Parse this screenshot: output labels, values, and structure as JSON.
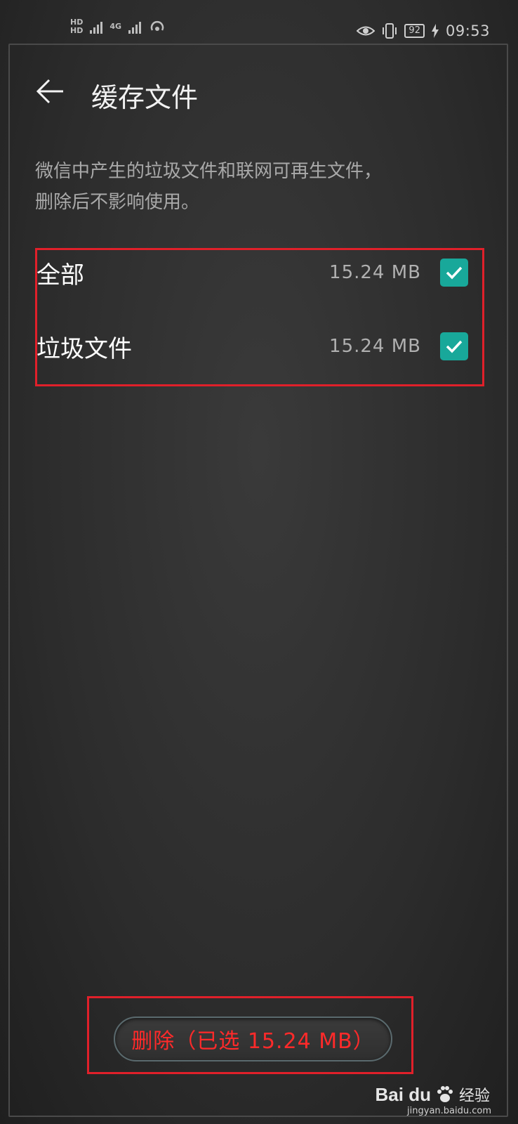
{
  "status_bar": {
    "left_indicators": [
      "HD",
      "4G",
      "4G"
    ],
    "battery": "92",
    "time": "09:53"
  },
  "header": {
    "title": "缓存文件"
  },
  "description": {
    "line1": "微信中产生的垃圾文件和联网可再生文件，",
    "line2": "删除后不影响使用。"
  },
  "items": [
    {
      "label": "全部",
      "size": "15.24  MB",
      "checked": true
    },
    {
      "label": "垃圾文件",
      "size": "15.24  MB",
      "checked": true
    }
  ],
  "delete_button": {
    "label": "删除（已选  15.24  MB）"
  },
  "watermark": {
    "brand": "Bai du",
    "cn": "经验",
    "url": "jingyan.baidu.com"
  },
  "colors": {
    "accent": "#18a89a",
    "highlight": "#e0202a",
    "delete_text": "#ff2a2a",
    "background": "#2c2c2c"
  }
}
